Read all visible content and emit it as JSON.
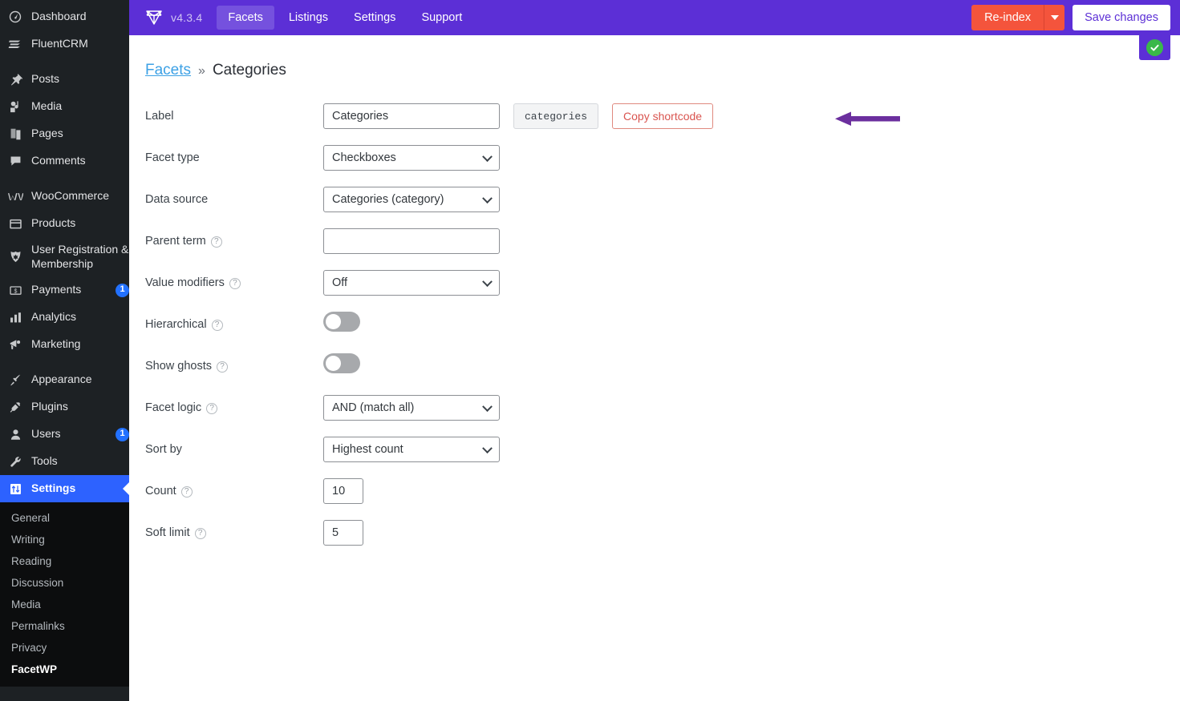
{
  "wp_sidebar": {
    "items": [
      {
        "label": "Dashboard",
        "icon": "dashboard-icon",
        "badge": null,
        "gap_after": true
      },
      {
        "label": "Posts",
        "icon": "pin-icon",
        "badge": null,
        "gap_after": false
      },
      {
        "label": "Media",
        "icon": "media-icon",
        "badge": null,
        "gap_after": false
      },
      {
        "label": "Pages",
        "icon": "pages-icon",
        "badge": null,
        "gap_after": false
      },
      {
        "label": "Comments",
        "icon": "comments-icon",
        "badge": null,
        "gap_after": true
      },
      {
        "label": "WooCommerce",
        "icon": "woocommerce-icon",
        "badge": null,
        "gap_after": false
      },
      {
        "label": "Products",
        "icon": "products-icon",
        "badge": null,
        "gap_after": false
      },
      {
        "label": "User Registration & Membership",
        "icon": "user-registration-icon",
        "badge": null,
        "gap_after": false
      },
      {
        "label": "Payments",
        "icon": "payments-icon",
        "badge": "1",
        "gap_after": false
      },
      {
        "label": "Analytics",
        "icon": "analytics-icon",
        "badge": null,
        "gap_after": false
      },
      {
        "label": "Marketing",
        "icon": "marketing-icon",
        "badge": null,
        "gap_after": true
      },
      {
        "label": "Appearance",
        "icon": "appearance-icon",
        "badge": null,
        "gap_after": false
      },
      {
        "label": "Plugins",
        "icon": "plugins-icon",
        "badge": null,
        "gap_after": false
      },
      {
        "label": "Users",
        "icon": "users-icon",
        "badge": "1",
        "gap_after": false
      },
      {
        "label": "Tools",
        "icon": "tools-icon",
        "badge": null,
        "gap_after": false
      }
    ],
    "active_item": {
      "label": "Settings",
      "icon": "settings-icon"
    },
    "submenu": [
      {
        "label": "General",
        "current": false
      },
      {
        "label": "Writing",
        "current": false
      },
      {
        "label": "Reading",
        "current": false
      },
      {
        "label": "Discussion",
        "current": false
      },
      {
        "label": "Media",
        "current": false
      },
      {
        "label": "Permalinks",
        "current": false
      },
      {
        "label": "Privacy",
        "current": false
      },
      {
        "label": "FacetWP",
        "current": true
      }
    ]
  },
  "topbar": {
    "version": "v4.3.4",
    "logo_icon": "gem-icon",
    "tabs": [
      {
        "label": "Facets",
        "active": true
      },
      {
        "label": "Listings",
        "active": false
      },
      {
        "label": "Settings",
        "active": false
      },
      {
        "label": "Support",
        "active": false
      }
    ],
    "reindex_label": "Re-index",
    "reindex_caret_icon": "caret-down-icon",
    "save_label": "Save changes",
    "status_icon": "green-check-icon",
    "accent_color": "#5c2fd6",
    "reindex_color": "#f4543c",
    "status_color": "#3ab84a"
  },
  "breadcrumb": {
    "parent": "Facets",
    "separator": "»",
    "current": "Categories"
  },
  "form": {
    "label": {
      "label": "Label",
      "value": "Categories",
      "placeholder": "",
      "shortcode_chip": "categories",
      "copy_button": "Copy shortcode"
    },
    "facet_type": {
      "label": "Facet type",
      "value": "Checkboxes"
    },
    "data_source": {
      "label": "Data source",
      "value": "Categories (category)"
    },
    "parent_term": {
      "label": "Parent term",
      "value": "",
      "placeholder": "",
      "has_help": true
    },
    "value_modifiers": {
      "label": "Value modifiers",
      "value": "Off",
      "has_help": true
    },
    "hierarchical": {
      "label": "Hierarchical",
      "state": "off",
      "has_help": true
    },
    "show_ghosts": {
      "label": "Show ghosts",
      "state": "off",
      "has_help": true
    },
    "facet_logic": {
      "label": "Facet logic",
      "value": "AND (match all)",
      "has_help": true
    },
    "sort_by": {
      "label": "Sort by",
      "value": "Highest count",
      "has_help": true
    },
    "count": {
      "label": "Count",
      "value": "10",
      "has_help": true
    },
    "soft_limit": {
      "label": "Soft limit",
      "value": "5",
      "has_help": true
    },
    "help_glyph": "?"
  },
  "annotation": {
    "arrow_color": "#6b2f9e",
    "direction": "left",
    "points_at": "Copy shortcode"
  }
}
